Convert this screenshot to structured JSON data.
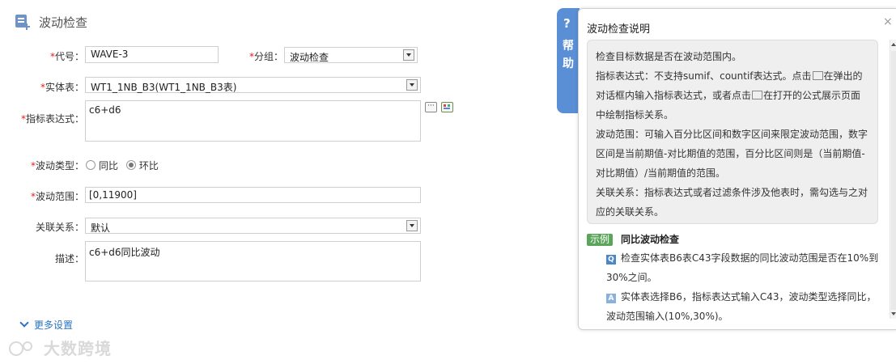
{
  "page": {
    "title": "波动检查"
  },
  "form": {
    "code_label": "代号：",
    "code_value": "WAVE-3",
    "group_label": "分组：",
    "group_value": "波动检查",
    "entity_label": "实体表：",
    "entity_value": "WT1_1NB_B3(WT1_1NB_B3表)",
    "expr_label": "指标表达式：",
    "expr_value": "c6+d6",
    "wave_type_label": "波动类型：",
    "wave_type_options": [
      "同比",
      "环比"
    ],
    "wave_type_selected": "环比",
    "wave_range_label": "波动范围：",
    "wave_range_value": "[0,11900]",
    "relation_label": "关联关系：",
    "relation_value": "默认",
    "desc_label": "描述：",
    "desc_value": "c6+d6同比波动",
    "required_mark": "*",
    "more_settings": "更多设置"
  },
  "help": {
    "tab_q": "?",
    "tab_text_1": "帮",
    "tab_text_2": "助",
    "title": "波动检查说明",
    "close": "×",
    "p1": "检查目标数据是否在波动范围内。",
    "p2a": "指标表达式：不支持sumif、countif表达式。点击",
    "p2b": "在弹出的",
    "p2c": "对话框内输入指标表达式，或者点击",
    "p2d": "在打开的公式展示页面",
    "p2e": "中绘制指标关系。",
    "p3a": "波动范围：可输入百分比区间和数字区间来限定波动范围，数字",
    "p3b": "区间是当前期值-对比期值的范围，百分比区间则是（当前期值-",
    "p3c": "对比期值）/当前期值的范围。",
    "p4a": "关联关系：指标表达式或者过滤条件涉及他表时，需勾选与之对",
    "p4b": "应的关联关系。",
    "example_badge": "示例",
    "example_title": "同比波动检查",
    "q_mark": "Q",
    "q_text_1": "检查实体表B6表C43字段数据的同比波动范围是否在10%到",
    "q_text_2": "30%之间。",
    "a_mark": "A",
    "a_text_1": "实体表选择B6，指标表达式输入C43，波动类型选择同比，",
    "a_text_2": "波动范围输入(10%,30%)。"
  },
  "watermark": "大数跨境",
  "colors": {
    "accent": "#5a8fd6",
    "required": "#e02020",
    "link": "#2a74c2"
  }
}
